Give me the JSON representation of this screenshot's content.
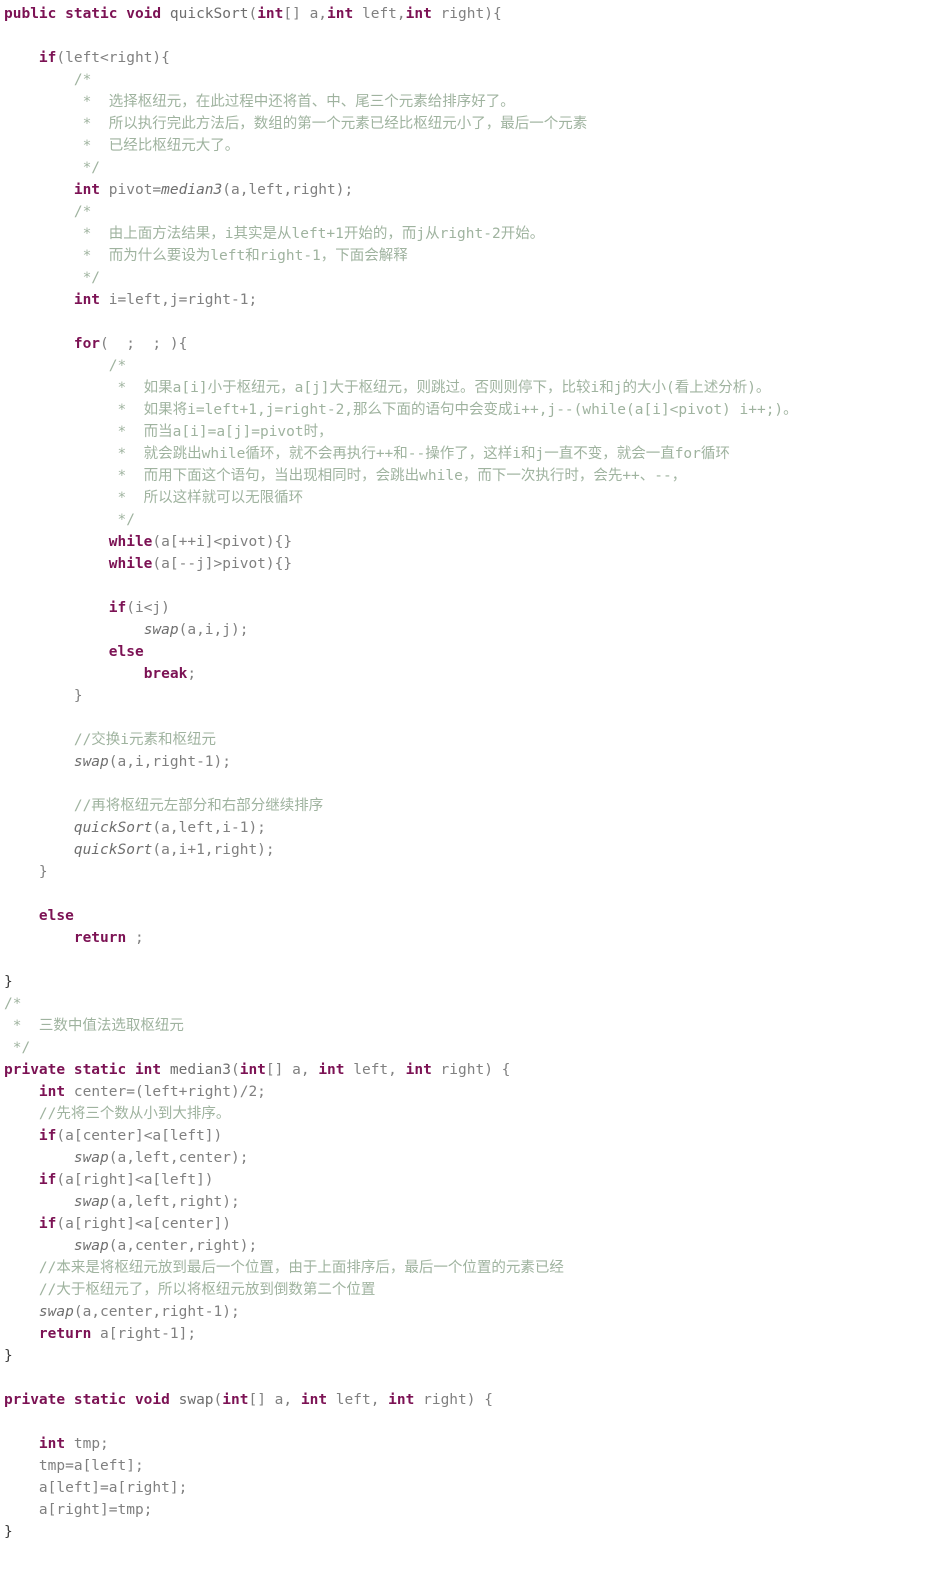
{
  "document": {
    "kind": "source-code-listing",
    "language": "Java",
    "background_color": "#ffffff",
    "colors": {
      "keyword": "#7c1254",
      "plain": "#808080",
      "comment": "#9fb39f",
      "method": "#6e6e6e",
      "brace": "#3c3c3c"
    }
  },
  "code": {
    "lines": [
      [
        {
          "t": "kw",
          "s": "public static void "
        },
        {
          "t": "dcl",
          "s": "quickSort"
        },
        {
          "t": "pln",
          "s": "("
        },
        {
          "t": "kw",
          "s": "int"
        },
        {
          "t": "pln",
          "s": "[] a,"
        },
        {
          "t": "kw",
          "s": "int"
        },
        {
          "t": "pln",
          "s": " left,"
        },
        {
          "t": "kw",
          "s": "int"
        },
        {
          "t": "pln",
          "s": " right){"
        }
      ],
      [],
      [
        {
          "t": "pln",
          "s": "    "
        },
        {
          "t": "kw",
          "s": "if"
        },
        {
          "t": "pln",
          "s": "(left<right){"
        }
      ],
      [
        {
          "t": "cmt",
          "s": "        /*"
        }
      ],
      [
        {
          "t": "cmt",
          "s": "         *  选择枢纽元，在此过程中还将首、中、尾三个元素给排序好了。"
        }
      ],
      [
        {
          "t": "cmt",
          "s": "         *  所以执行完此方法后，数组的第一个元素已经比枢纽元小了，最后一个元素"
        }
      ],
      [
        {
          "t": "cmt",
          "s": "         *  已经比枢纽元大了。"
        }
      ],
      [
        {
          "t": "cmt",
          "s": "         */"
        }
      ],
      [
        {
          "t": "pln",
          "s": "        "
        },
        {
          "t": "kw",
          "s": "int"
        },
        {
          "t": "pln",
          "s": " pivot="
        },
        {
          "t": "mth",
          "s": "median3"
        },
        {
          "t": "pln",
          "s": "(a,left,right);"
        }
      ],
      [
        {
          "t": "cmt",
          "s": "        /*"
        }
      ],
      [
        {
          "t": "cmt",
          "s": "         *  由上面方法结果，i其实是从left+1开始的，而j从right-2开始。"
        }
      ],
      [
        {
          "t": "cmt",
          "s": "         *  而为什么要设为left和right-1，下面会解释"
        }
      ],
      [
        {
          "t": "cmt",
          "s": "         */"
        }
      ],
      [
        {
          "t": "pln",
          "s": "        "
        },
        {
          "t": "kw",
          "s": "int"
        },
        {
          "t": "pln",
          "s": " i=left,j=right-1;"
        }
      ],
      [],
      [
        {
          "t": "pln",
          "s": "        "
        },
        {
          "t": "kw",
          "s": "for"
        },
        {
          "t": "pln",
          "s": "(  ;  ; ){"
        }
      ],
      [
        {
          "t": "cmt",
          "s": "            /*"
        }
      ],
      [
        {
          "t": "cmt",
          "s": "             *  如果a[i]小于枢纽元，a[j]大于枢纽元，则跳过。否则则停下，比较i和j的大小(看上述分析)。"
        }
      ],
      [
        {
          "t": "cmt",
          "s": "             *  如果将i=left+1,j=right-2,那么下面的语句中会变成i++,j--(while(a[i]<pivot) i++;)。"
        }
      ],
      [
        {
          "t": "cmt",
          "s": "             *  而当a[i]=a[j]=pivot时，"
        }
      ],
      [
        {
          "t": "cmt",
          "s": "             *  就会跳出while循环，就不会再执行++和--操作了，这样i和j一直不变，就会一直for循环"
        }
      ],
      [
        {
          "t": "cmt",
          "s": "             *  而用下面这个语句，当出现相同时，会跳出while，而下一次执行时，会先++、--，"
        }
      ],
      [
        {
          "t": "cmt",
          "s": "             *  所以这样就可以无限循环"
        }
      ],
      [
        {
          "t": "cmt",
          "s": "             */"
        }
      ],
      [
        {
          "t": "pln",
          "s": "            "
        },
        {
          "t": "kw",
          "s": "while"
        },
        {
          "t": "pln",
          "s": "(a[++i]<pivot){}"
        }
      ],
      [
        {
          "t": "pln",
          "s": "            "
        },
        {
          "t": "kw",
          "s": "while"
        },
        {
          "t": "pln",
          "s": "(a[--j]>pivot){}"
        }
      ],
      [],
      [
        {
          "t": "pln",
          "s": "            "
        },
        {
          "t": "kw",
          "s": "if"
        },
        {
          "t": "pln",
          "s": "(i<j)"
        }
      ],
      [
        {
          "t": "pln",
          "s": "                "
        },
        {
          "t": "mth",
          "s": "swap"
        },
        {
          "t": "pln",
          "s": "(a,i,j);"
        }
      ],
      [
        {
          "t": "pln",
          "s": "            "
        },
        {
          "t": "kw",
          "s": "else"
        }
      ],
      [
        {
          "t": "pln",
          "s": "                "
        },
        {
          "t": "kw",
          "s": "break"
        },
        {
          "t": "pln",
          "s": ";"
        }
      ],
      [
        {
          "t": "pln",
          "s": "        }"
        }
      ],
      [],
      [
        {
          "t": "cmt",
          "s": "        //交换i元素和枢纽元"
        }
      ],
      [
        {
          "t": "pln",
          "s": "        "
        },
        {
          "t": "mth",
          "s": "swap"
        },
        {
          "t": "pln",
          "s": "(a,i,right-1);"
        }
      ],
      [],
      [
        {
          "t": "cmt",
          "s": "        //再将枢纽元左部分和右部分继续排序"
        }
      ],
      [
        {
          "t": "pln",
          "s": "        "
        },
        {
          "t": "mth",
          "s": "quickSort"
        },
        {
          "t": "pln",
          "s": "(a,left,i-1);"
        }
      ],
      [
        {
          "t": "pln",
          "s": "        "
        },
        {
          "t": "mth",
          "s": "quickSort"
        },
        {
          "t": "pln",
          "s": "(a,i+1,right);"
        }
      ],
      [
        {
          "t": "pln",
          "s": "    }"
        }
      ],
      [],
      [
        {
          "t": "pln",
          "s": "    "
        },
        {
          "t": "kw",
          "s": "else"
        }
      ],
      [
        {
          "t": "pln",
          "s": "        "
        },
        {
          "t": "kw",
          "s": "return"
        },
        {
          "t": "pln",
          "s": " ;"
        }
      ],
      [],
      [
        {
          "t": "punc",
          "s": "}"
        }
      ],
      [
        {
          "t": "cmt",
          "s": "/*"
        }
      ],
      [
        {
          "t": "cmt",
          "s": " *  三数中值法选取枢纽元"
        }
      ],
      [
        {
          "t": "cmt",
          "s": " */"
        }
      ],
      [
        {
          "t": "kw",
          "s": "private static int "
        },
        {
          "t": "dcl",
          "s": "median3"
        },
        {
          "t": "pln",
          "s": "("
        },
        {
          "t": "kw",
          "s": "int"
        },
        {
          "t": "pln",
          "s": "[] a, "
        },
        {
          "t": "kw",
          "s": "int"
        },
        {
          "t": "pln",
          "s": " left, "
        },
        {
          "t": "kw",
          "s": "int"
        },
        {
          "t": "pln",
          "s": " right) {"
        }
      ],
      [
        {
          "t": "pln",
          "s": "    "
        },
        {
          "t": "kw",
          "s": "int"
        },
        {
          "t": "pln",
          "s": " center=(left+right)/2;"
        }
      ],
      [
        {
          "t": "cmt",
          "s": "    //先将三个数从小到大排序。"
        }
      ],
      [
        {
          "t": "pln",
          "s": "    "
        },
        {
          "t": "kw",
          "s": "if"
        },
        {
          "t": "pln",
          "s": "(a[center]<a[left])"
        }
      ],
      [
        {
          "t": "pln",
          "s": "        "
        },
        {
          "t": "mth",
          "s": "swap"
        },
        {
          "t": "pln",
          "s": "(a,left,center);"
        }
      ],
      [
        {
          "t": "pln",
          "s": "    "
        },
        {
          "t": "kw",
          "s": "if"
        },
        {
          "t": "pln",
          "s": "(a[right]<a[left])"
        }
      ],
      [
        {
          "t": "pln",
          "s": "        "
        },
        {
          "t": "mth",
          "s": "swap"
        },
        {
          "t": "pln",
          "s": "(a,left,right);"
        }
      ],
      [
        {
          "t": "pln",
          "s": "    "
        },
        {
          "t": "kw",
          "s": "if"
        },
        {
          "t": "pln",
          "s": "(a[right]<a[center])"
        }
      ],
      [
        {
          "t": "pln",
          "s": "        "
        },
        {
          "t": "mth",
          "s": "swap"
        },
        {
          "t": "pln",
          "s": "(a,center,right);"
        }
      ],
      [
        {
          "t": "cmt",
          "s": "    //本来是将枢纽元放到最后一个位置，由于上面排序后，最后一个位置的元素已经"
        }
      ],
      [
        {
          "t": "cmt",
          "s": "    //大于枢纽元了，所以将枢纽元放到倒数第二个位置"
        }
      ],
      [
        {
          "t": "pln",
          "s": "    "
        },
        {
          "t": "mth",
          "s": "swap"
        },
        {
          "t": "pln",
          "s": "(a,center,right-1);"
        }
      ],
      [
        {
          "t": "pln",
          "s": "    "
        },
        {
          "t": "kw",
          "s": "return"
        },
        {
          "t": "pln",
          "s": " a[right-1];"
        }
      ],
      [
        {
          "t": "punc",
          "s": "}"
        }
      ],
      [],
      [
        {
          "t": "kw",
          "s": "private static void "
        },
        {
          "t": "dcl",
          "s": "swap"
        },
        {
          "t": "pln",
          "s": "("
        },
        {
          "t": "kw",
          "s": "int"
        },
        {
          "t": "pln",
          "s": "[] a, "
        },
        {
          "t": "kw",
          "s": "int"
        },
        {
          "t": "pln",
          "s": " left, "
        },
        {
          "t": "kw",
          "s": "int"
        },
        {
          "t": "pln",
          "s": " right) {"
        }
      ],
      [],
      [
        {
          "t": "pln",
          "s": "    "
        },
        {
          "t": "kw",
          "s": "int"
        },
        {
          "t": "pln",
          "s": " tmp;"
        }
      ],
      [
        {
          "t": "pln",
          "s": "    tmp=a[left];"
        }
      ],
      [
        {
          "t": "pln",
          "s": "    a[left]=a[right];"
        }
      ],
      [
        {
          "t": "pln",
          "s": "    a[right]=tmp;"
        }
      ],
      [
        {
          "t": "punc",
          "s": "}"
        }
      ]
    ]
  }
}
